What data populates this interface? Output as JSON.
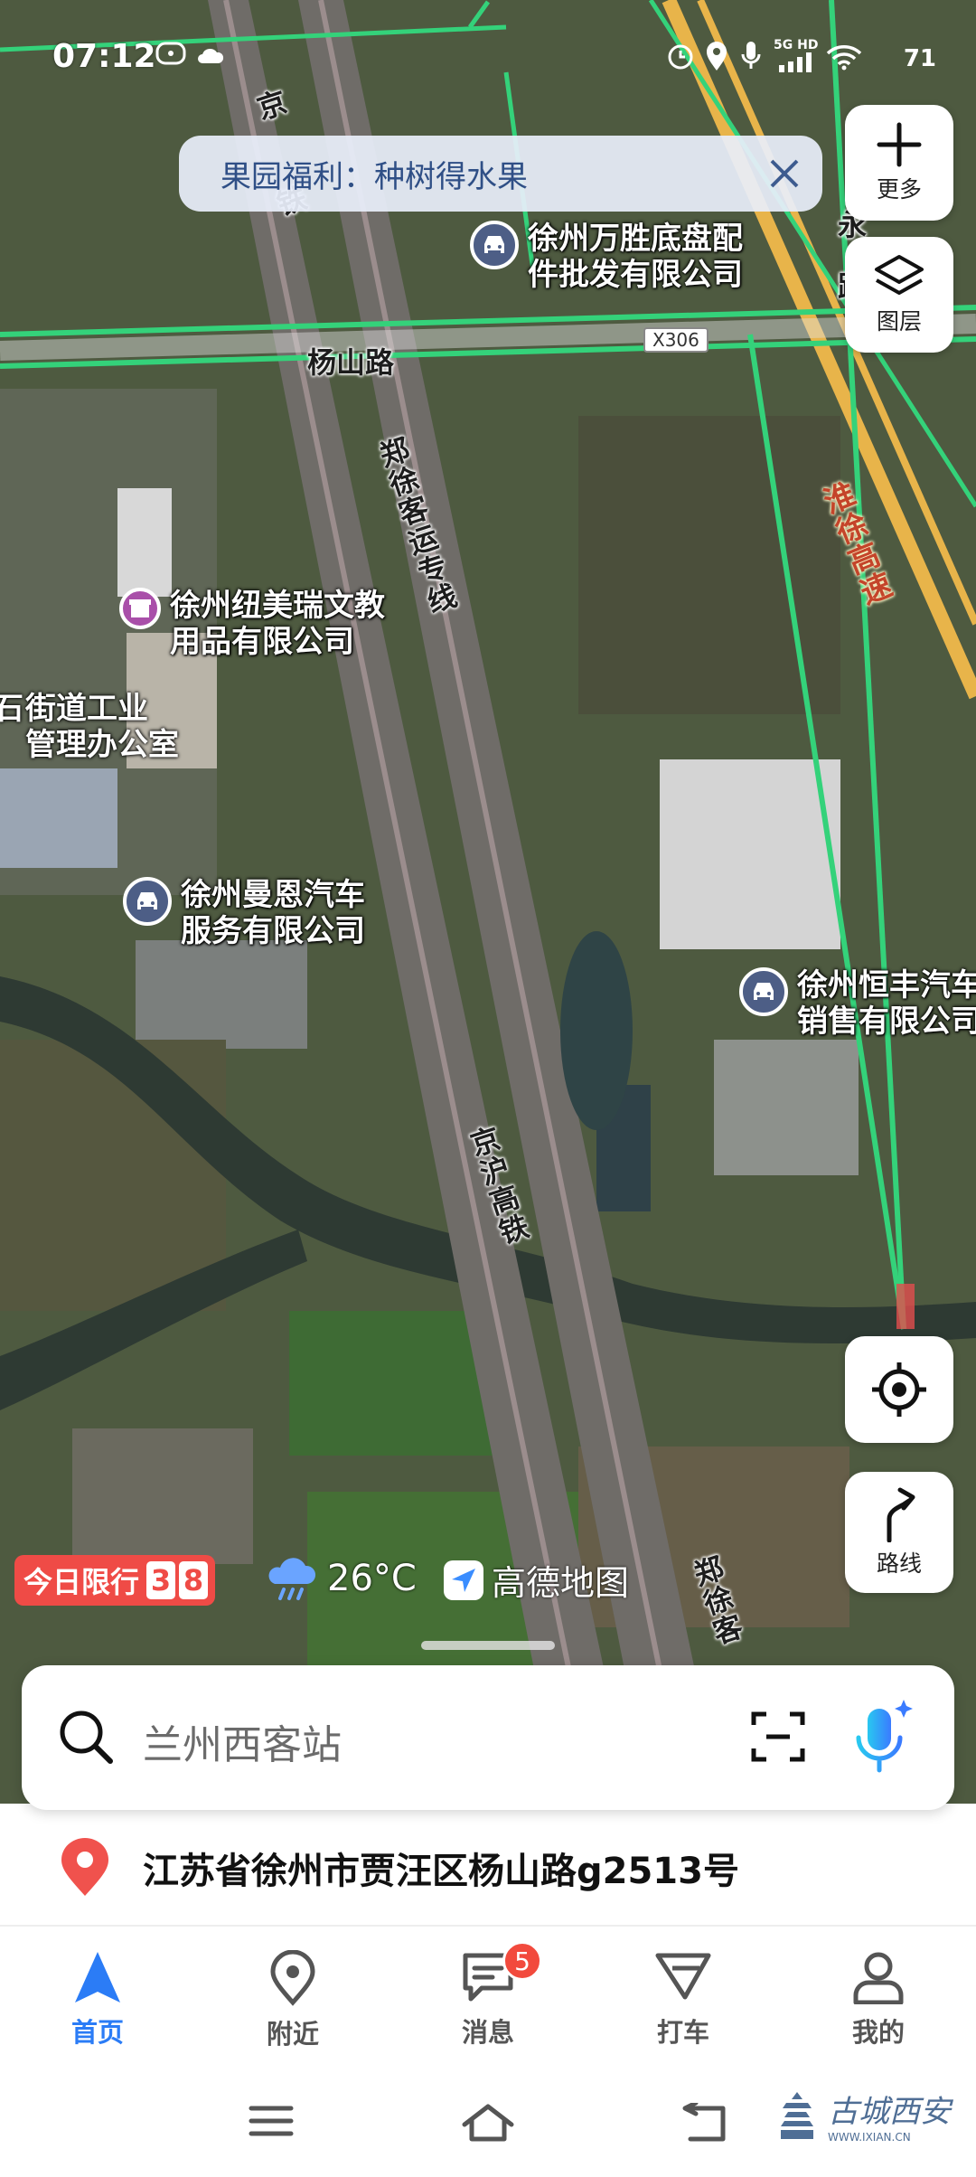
{
  "status_bar": {
    "time": "07:12",
    "battery": "71",
    "network": "5G HD"
  },
  "banner": {
    "text": "果园福利：种树得水果"
  },
  "map": {
    "roads": {
      "yangshan": "杨山路",
      "x306": "X306",
      "zhengxu_line": "郑徐客运专线",
      "jinghu_hsr": "京沪高铁",
      "zhengxu_bottom": "郑徐客",
      "huaixu_expressway": "淮徐高速",
      "jing_top": "京",
      "tie_top": "铁",
      "yong_right": "永",
      "lu_right": "路"
    },
    "pois": [
      {
        "name": "徐州万胜底盘配\n件批发有限公司"
      },
      {
        "name": "徐州纽美瑞文教\n用品有限公司"
      },
      {
        "name": "徐州曼恩汽车\n服务有限公司"
      },
      {
        "name": "徐州恒丰汽车\n销售有限公司"
      }
    ],
    "area_label": "街道工业\n管理办公室",
    "area_label_prefix": "石"
  },
  "right_controls": {
    "more": "更多",
    "layers": "图层",
    "route": "路线"
  },
  "info_row": {
    "restriction_label": "今日限行",
    "restriction_numbers": [
      "3",
      "8"
    ],
    "temperature": "26°C",
    "brand": "高德地图"
  },
  "search": {
    "placeholder": "兰州西客站"
  },
  "current_location": {
    "address": "江苏省徐州市贾汪区杨山路g2513号"
  },
  "tabs": [
    {
      "label": "首页"
    },
    {
      "label": "附近"
    },
    {
      "label": "消息",
      "badge": "5"
    },
    {
      "label": "打车"
    },
    {
      "label": "我的"
    }
  ],
  "watermark": {
    "text": "古城西安",
    "url": "WWW.IXIAN.CN"
  },
  "colors": {
    "accent": "#2b7cf6",
    "badge": "#f24a3d",
    "restriction": "#ef4b46",
    "road_green": "#34d27a",
    "highway": "#e8b44a"
  }
}
